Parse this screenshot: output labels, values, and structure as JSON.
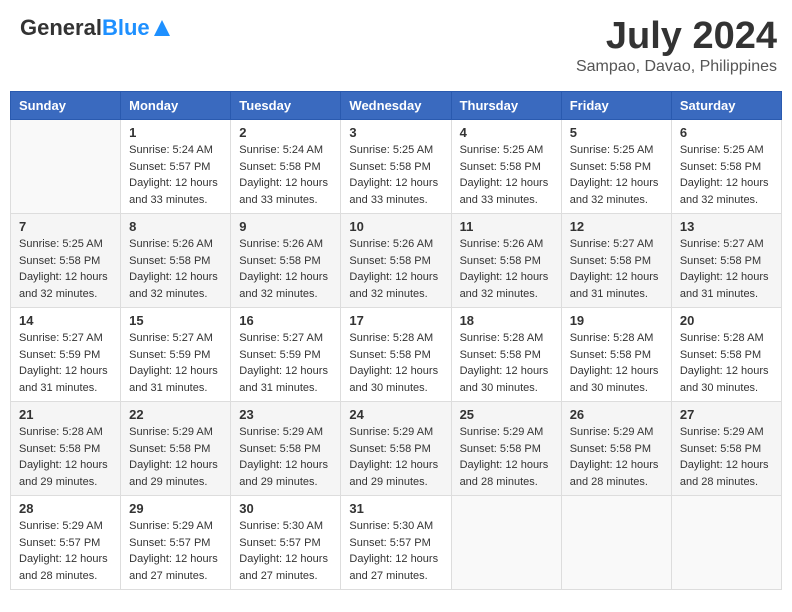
{
  "header": {
    "logo_general": "General",
    "logo_blue": "Blue",
    "month": "July 2024",
    "location": "Sampao, Davao, Philippines"
  },
  "days_of_week": [
    "Sunday",
    "Monday",
    "Tuesday",
    "Wednesday",
    "Thursday",
    "Friday",
    "Saturday"
  ],
  "weeks": [
    [
      {
        "day": "",
        "info": ""
      },
      {
        "day": "1",
        "info": "Sunrise: 5:24 AM\nSunset: 5:57 PM\nDaylight: 12 hours\nand 33 minutes."
      },
      {
        "day": "2",
        "info": "Sunrise: 5:24 AM\nSunset: 5:58 PM\nDaylight: 12 hours\nand 33 minutes."
      },
      {
        "day": "3",
        "info": "Sunrise: 5:25 AM\nSunset: 5:58 PM\nDaylight: 12 hours\nand 33 minutes."
      },
      {
        "day": "4",
        "info": "Sunrise: 5:25 AM\nSunset: 5:58 PM\nDaylight: 12 hours\nand 33 minutes."
      },
      {
        "day": "5",
        "info": "Sunrise: 5:25 AM\nSunset: 5:58 PM\nDaylight: 12 hours\nand 32 minutes."
      },
      {
        "day": "6",
        "info": "Sunrise: 5:25 AM\nSunset: 5:58 PM\nDaylight: 12 hours\nand 32 minutes."
      }
    ],
    [
      {
        "day": "7",
        "info": "Sunrise: 5:25 AM\nSunset: 5:58 PM\nDaylight: 12 hours\nand 32 minutes."
      },
      {
        "day": "8",
        "info": "Sunrise: 5:26 AM\nSunset: 5:58 PM\nDaylight: 12 hours\nand 32 minutes."
      },
      {
        "day": "9",
        "info": "Sunrise: 5:26 AM\nSunset: 5:58 PM\nDaylight: 12 hours\nand 32 minutes."
      },
      {
        "day": "10",
        "info": "Sunrise: 5:26 AM\nSunset: 5:58 PM\nDaylight: 12 hours\nand 32 minutes."
      },
      {
        "day": "11",
        "info": "Sunrise: 5:26 AM\nSunset: 5:58 PM\nDaylight: 12 hours\nand 32 minutes."
      },
      {
        "day": "12",
        "info": "Sunrise: 5:27 AM\nSunset: 5:58 PM\nDaylight: 12 hours\nand 31 minutes."
      },
      {
        "day": "13",
        "info": "Sunrise: 5:27 AM\nSunset: 5:58 PM\nDaylight: 12 hours\nand 31 minutes."
      }
    ],
    [
      {
        "day": "14",
        "info": "Sunrise: 5:27 AM\nSunset: 5:59 PM\nDaylight: 12 hours\nand 31 minutes."
      },
      {
        "day": "15",
        "info": "Sunrise: 5:27 AM\nSunset: 5:59 PM\nDaylight: 12 hours\nand 31 minutes."
      },
      {
        "day": "16",
        "info": "Sunrise: 5:27 AM\nSunset: 5:59 PM\nDaylight: 12 hours\nand 31 minutes."
      },
      {
        "day": "17",
        "info": "Sunrise: 5:28 AM\nSunset: 5:58 PM\nDaylight: 12 hours\nand 30 minutes."
      },
      {
        "day": "18",
        "info": "Sunrise: 5:28 AM\nSunset: 5:58 PM\nDaylight: 12 hours\nand 30 minutes."
      },
      {
        "day": "19",
        "info": "Sunrise: 5:28 AM\nSunset: 5:58 PM\nDaylight: 12 hours\nand 30 minutes."
      },
      {
        "day": "20",
        "info": "Sunrise: 5:28 AM\nSunset: 5:58 PM\nDaylight: 12 hours\nand 30 minutes."
      }
    ],
    [
      {
        "day": "21",
        "info": "Sunrise: 5:28 AM\nSunset: 5:58 PM\nDaylight: 12 hours\nand 29 minutes."
      },
      {
        "day": "22",
        "info": "Sunrise: 5:29 AM\nSunset: 5:58 PM\nDaylight: 12 hours\nand 29 minutes."
      },
      {
        "day": "23",
        "info": "Sunrise: 5:29 AM\nSunset: 5:58 PM\nDaylight: 12 hours\nand 29 minutes."
      },
      {
        "day": "24",
        "info": "Sunrise: 5:29 AM\nSunset: 5:58 PM\nDaylight: 12 hours\nand 29 minutes."
      },
      {
        "day": "25",
        "info": "Sunrise: 5:29 AM\nSunset: 5:58 PM\nDaylight: 12 hours\nand 28 minutes."
      },
      {
        "day": "26",
        "info": "Sunrise: 5:29 AM\nSunset: 5:58 PM\nDaylight: 12 hours\nand 28 minutes."
      },
      {
        "day": "27",
        "info": "Sunrise: 5:29 AM\nSunset: 5:58 PM\nDaylight: 12 hours\nand 28 minutes."
      }
    ],
    [
      {
        "day": "28",
        "info": "Sunrise: 5:29 AM\nSunset: 5:57 PM\nDaylight: 12 hours\nand 28 minutes."
      },
      {
        "day": "29",
        "info": "Sunrise: 5:29 AM\nSunset: 5:57 PM\nDaylight: 12 hours\nand 27 minutes."
      },
      {
        "day": "30",
        "info": "Sunrise: 5:30 AM\nSunset: 5:57 PM\nDaylight: 12 hours\nand 27 minutes."
      },
      {
        "day": "31",
        "info": "Sunrise: 5:30 AM\nSunset: 5:57 PM\nDaylight: 12 hours\nand 27 minutes."
      },
      {
        "day": "",
        "info": ""
      },
      {
        "day": "",
        "info": ""
      },
      {
        "day": "",
        "info": ""
      }
    ]
  ]
}
